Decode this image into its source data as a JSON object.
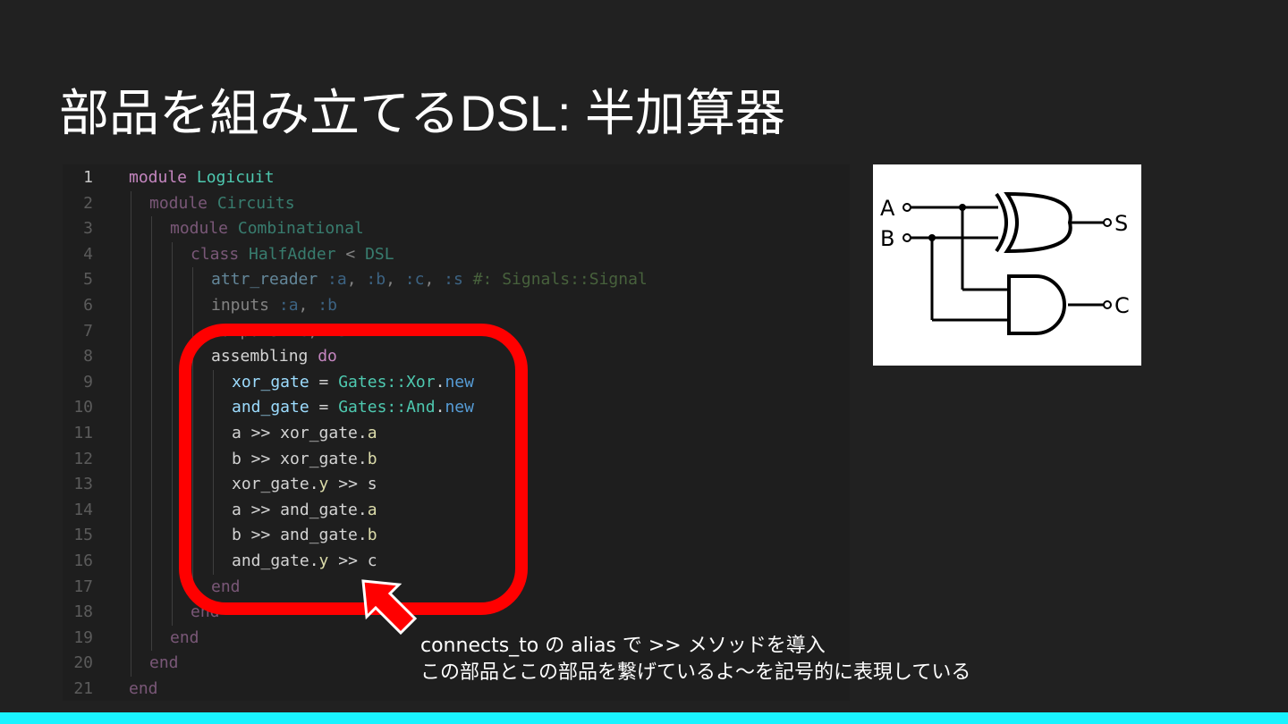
{
  "title": "部品を組み立てるDSL: 半加算器",
  "code": {
    "lines": [
      {
        "n": "1",
        "segs": [
          [
            "module ",
            "kw"
          ],
          [
            "Logicuit",
            "cls"
          ]
        ]
      },
      {
        "n": "2",
        "segs": [
          [
            "module ",
            "kw"
          ],
          [
            "Circuits",
            "cls"
          ]
        ]
      },
      {
        "n": "3",
        "segs": [
          [
            "module ",
            "kw"
          ],
          [
            "Combinational",
            "cls"
          ]
        ]
      },
      {
        "n": "4",
        "segs": [
          [
            "class ",
            "kw"
          ],
          [
            "HalfAdder",
            "cls"
          ],
          [
            " < ",
            "plain"
          ],
          [
            "DSL",
            "cls"
          ]
        ]
      },
      {
        "n": "5",
        "segs": [
          [
            "attr_reader ",
            "var"
          ],
          [
            ":a",
            "sym"
          ],
          [
            ", ",
            "plain"
          ],
          [
            ":b",
            "sym"
          ],
          [
            ", ",
            "plain"
          ],
          [
            ":c",
            "sym"
          ],
          [
            ", ",
            "plain"
          ],
          [
            ":s",
            "sym"
          ],
          [
            " #: Signals::Signal",
            "com"
          ]
        ]
      },
      {
        "n": "6",
        "segs": [
          [
            "inputs ",
            "plain"
          ],
          [
            ":a",
            "sym"
          ],
          [
            ", ",
            "plain"
          ],
          [
            ":b",
            "sym"
          ]
        ]
      },
      {
        "n": "7",
        "segs": [
          [
            "outputs ",
            "plain"
          ],
          [
            ":c",
            "sym"
          ],
          [
            ", ",
            "plain"
          ],
          [
            ":s",
            "sym"
          ]
        ]
      },
      {
        "n": "8",
        "segs": [
          [
            "assembling ",
            "plain"
          ],
          [
            "do",
            "kw"
          ]
        ]
      },
      {
        "n": "9",
        "segs": [
          [
            "xor_gate",
            "var"
          ],
          [
            " = ",
            "plain"
          ],
          [
            "Gates::Xor",
            "cls"
          ],
          [
            ".",
            "plain"
          ],
          [
            "new",
            "sym"
          ]
        ]
      },
      {
        "n": "10",
        "segs": [
          [
            "and_gate",
            "var"
          ],
          [
            " = ",
            "plain"
          ],
          [
            "Gates::And",
            "cls"
          ],
          [
            ".",
            "plain"
          ],
          [
            "new",
            "sym"
          ]
        ]
      },
      {
        "n": "11",
        "segs": [
          [
            "a >> xor_gate.",
            "plain"
          ],
          [
            "a",
            "fn"
          ]
        ]
      },
      {
        "n": "12",
        "segs": [
          [
            "b >> xor_gate.",
            "plain"
          ],
          [
            "b",
            "fn"
          ]
        ]
      },
      {
        "n": "13",
        "segs": [
          [
            "xor_gate.",
            "plain"
          ],
          [
            "y",
            "fn"
          ],
          [
            " >> s",
            "plain"
          ]
        ]
      },
      {
        "n": "14",
        "segs": [
          [
            "a >> and_gate.",
            "plain"
          ],
          [
            "a",
            "fn"
          ]
        ]
      },
      {
        "n": "15",
        "segs": [
          [
            "b >> and_gate.",
            "plain"
          ],
          [
            "b",
            "fn"
          ]
        ]
      },
      {
        "n": "16",
        "segs": [
          [
            "and_gate.",
            "plain"
          ],
          [
            "y",
            "fn"
          ],
          [
            " >> c",
            "plain"
          ]
        ]
      },
      {
        "n": "17",
        "segs": [
          [
            "end",
            "kw"
          ]
        ]
      },
      {
        "n": "18",
        "segs": [
          [
            "end",
            "kw"
          ]
        ]
      },
      {
        "n": "19",
        "segs": [
          [
            "end",
            "kw"
          ]
        ]
      },
      {
        "n": "20",
        "segs": [
          [
            "end",
            "kw"
          ]
        ]
      },
      {
        "n": "21",
        "segs": [
          [
            "end",
            "kw"
          ]
        ]
      }
    ]
  },
  "diagram": {
    "input_a": "A",
    "input_b": "B",
    "output_s": "S",
    "output_c": "C"
  },
  "caption": {
    "line1": "connects_to の alias で >> メソッドを導入",
    "line2": "この部品とこの部品を繋げているよ〜を記号的に表現している"
  },
  "colors": {
    "highlight": "#ff0000",
    "accent_bar": "#19f3ff"
  },
  "icons": {
    "arrow": "arrow-up-left-icon"
  }
}
